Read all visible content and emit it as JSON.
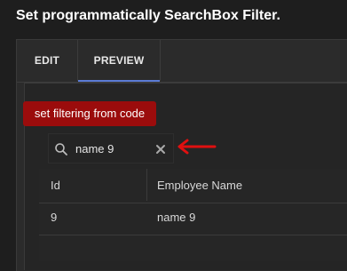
{
  "page": {
    "title": "Set programmatically SearchBox Filter."
  },
  "tabs": [
    {
      "label": "EDIT",
      "active": false
    },
    {
      "label": "PREVIEW",
      "active": true
    }
  ],
  "action_button": {
    "label": "set filtering from code",
    "color": "#9b0c0c"
  },
  "search": {
    "value": "name 9",
    "icon": "search-icon",
    "clear_icon": "close-icon"
  },
  "annotation": {
    "icon": "arrow-left-icon",
    "color": "#e01010"
  },
  "table": {
    "columns": [
      "Id",
      "Employee Name"
    ],
    "rows": [
      [
        "9",
        "name 9"
      ]
    ]
  },
  "colors": {
    "background": "#1e1e1e",
    "panel": "#2b2b2b",
    "active_tab_underline": "#5b7bd5",
    "text": "#ffffff"
  }
}
